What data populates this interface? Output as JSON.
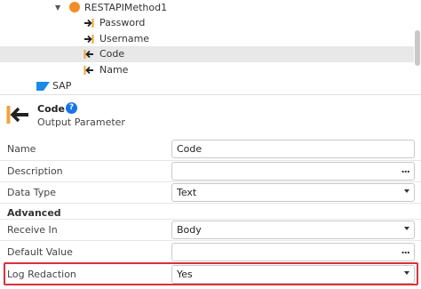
{
  "tree": {
    "method": "RESTAPIMethod1",
    "items": [
      {
        "label": "Password",
        "kind": "input",
        "icon": "input-parameter-icon"
      },
      {
        "label": "Username",
        "kind": "input",
        "icon": "input-parameter-icon"
      },
      {
        "label": "Code",
        "kind": "output",
        "icon": "output-parameter-icon",
        "selected": true
      },
      {
        "label": "Name",
        "kind": "output",
        "icon": "output-parameter-icon"
      }
    ],
    "sap": "SAP"
  },
  "header": {
    "title": "Code",
    "subtitle": "Output Parameter",
    "help": "?"
  },
  "properties": {
    "name": {
      "label": "Name",
      "value": "Code"
    },
    "description": {
      "label": "Description",
      "value": "",
      "button": "..."
    },
    "data_type": {
      "label": "Data Type",
      "value": "Text"
    },
    "advanced_title": "Advanced",
    "receive_in": {
      "label": "Receive In",
      "value": "Body"
    },
    "default_value": {
      "label": "Default Value",
      "value": "",
      "button": "..."
    },
    "log_redaction": {
      "label": "Log Redaction",
      "value": "Yes"
    }
  },
  "colors": {
    "accent": "#1a73e8",
    "method_dot": "#f28c28",
    "highlight": "#d9313a",
    "selected_row": "#e8e8e8"
  }
}
